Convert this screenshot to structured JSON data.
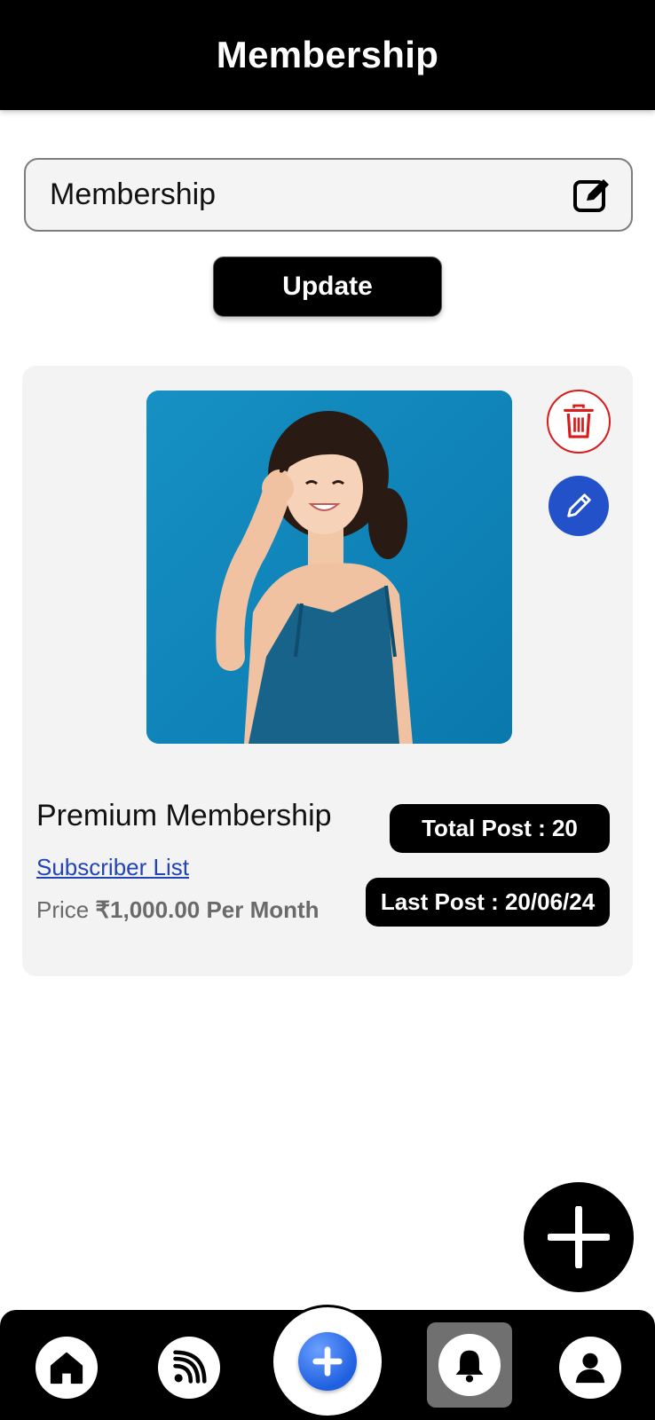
{
  "header": {
    "title": "Membership"
  },
  "name_field": {
    "value": "Membership",
    "edit_icon": "edit-square-icon"
  },
  "update_button": {
    "label": "Update"
  },
  "membership_card": {
    "image_description_icon": "photo",
    "title": "Premium Membership",
    "subscriber_link": "Subscriber List",
    "price_label": "Price",
    "price_value": "₹1,000.00 Per Month",
    "total_post": "Total Post : 20",
    "last_post": "Last Post : 20/06/24",
    "delete_icon": "trash-icon",
    "edit_icon": "pencil-icon"
  },
  "fab": {
    "icon": "plus-icon"
  },
  "bottom_nav": {
    "items": [
      "home-icon",
      "feed-icon",
      "add-icon",
      "bell-icon",
      "profile-icon"
    ],
    "active": "bell-icon"
  },
  "colors": {
    "header_bg": "#000000",
    "accent_blue": "#2251c9",
    "delete_red": "#d81b1b",
    "card_bg": "#f3f3f3",
    "link_blue": "#2145b5"
  }
}
